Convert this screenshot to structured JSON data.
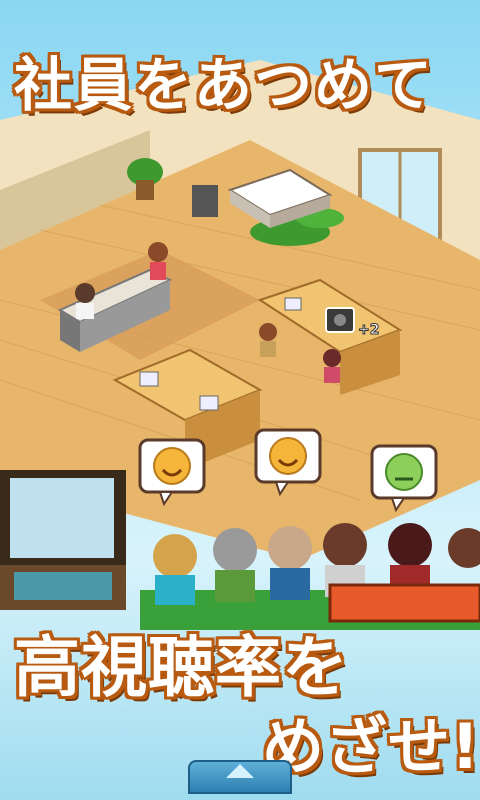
{
  "banner_top": "社員をあつめて",
  "banner_bottom_line1": "高視聴率を",
  "banner_bottom_line2": "めざせ!!",
  "bonus_label": "+2",
  "colors": {
    "title_fill": "#ffffff",
    "title_outline": "#b85a10",
    "floor": "#e7b66a",
    "wall": "#f3e2bf"
  },
  "icons": [
    "smiley-happy-icon",
    "smiley-happy-icon",
    "smiley-neutral-icon",
    "camera-icon",
    "scroll-up-arrow-icon"
  ]
}
